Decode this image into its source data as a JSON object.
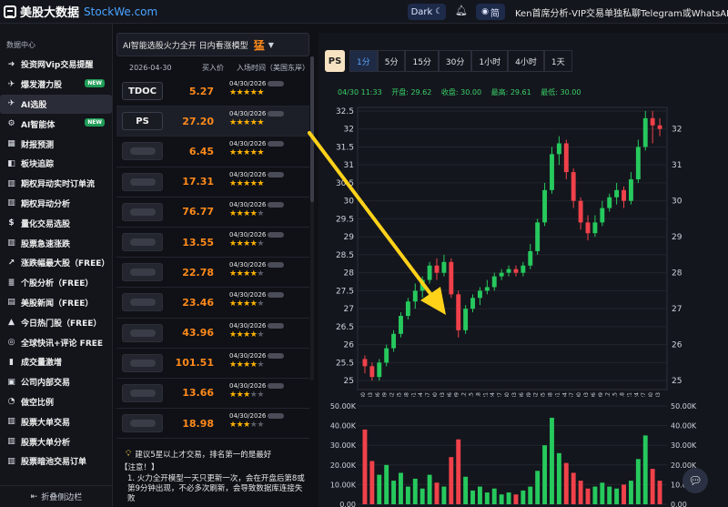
{
  "header": {
    "logo_cn": "美股大数据",
    "logo_en": "StockWe.com",
    "theme_label": "Dark",
    "lang_label": "简",
    "contact": "Ken首席分析-VIP交易单独私聊Telegram或WhatsAPP~"
  },
  "sidebar": {
    "section_label": "数据中心",
    "items": [
      {
        "label": "投资网Vip交易提醒",
        "icon": "arrow-icon",
        "badge": ""
      },
      {
        "label": "爆发潜力股",
        "icon": "rocket-icon",
        "badge": "NEW"
      },
      {
        "label": "AI选股",
        "icon": "plane-icon",
        "badge": "",
        "active": true
      },
      {
        "label": "AI智能体",
        "icon": "robot-icon",
        "badge": "NEW"
      },
      {
        "label": "财报预测",
        "icon": "grid-icon",
        "badge": ""
      },
      {
        "label": "板块追踪",
        "icon": "box-icon",
        "badge": ""
      },
      {
        "label": "期权异动实时订单流",
        "icon": "chart-icon",
        "badge": ""
      },
      {
        "label": "期权异动分析",
        "icon": "chart-icon",
        "badge": ""
      },
      {
        "label": "量化交易选股",
        "icon": "dollar-icon",
        "badge": ""
      },
      {
        "label": "股票急速涨跌",
        "icon": "chart-icon",
        "badge": ""
      },
      {
        "label": "涨跌幅最大股（FREE）",
        "icon": "trend-icon",
        "badge": ""
      },
      {
        "label": "个股分析（FREE）",
        "icon": "list-icon",
        "badge": ""
      },
      {
        "label": "美股新闻（FREE）",
        "icon": "news-icon",
        "badge": ""
      },
      {
        "label": "今日热门股（FREE）",
        "icon": "hot-icon",
        "badge": ""
      },
      {
        "label": "全球快讯+评论 FREE",
        "icon": "globe-icon",
        "badge": ""
      },
      {
        "label": "成交量激增",
        "icon": "volume-icon",
        "badge": ""
      },
      {
        "label": "公司内部交易",
        "icon": "building-icon",
        "badge": ""
      },
      {
        "label": "做空比例",
        "icon": "pie-icon",
        "badge": ""
      },
      {
        "label": "股票大单交易",
        "icon": "chart-icon",
        "badge": ""
      },
      {
        "label": "股票大单分析",
        "icon": "chart-icon",
        "badge": ""
      },
      {
        "label": "股票暗池交易订单",
        "icon": "chart-icon",
        "badge": ""
      }
    ],
    "collapse_label": "折叠侧边栏"
  },
  "model": {
    "title": "AI智能选股火力全开 日内看涨模型",
    "hot_mark": "猛"
  },
  "list": {
    "headers": {
      "date": "2026-04-30",
      "price": "买入价",
      "time": "入场时间（美国东岸）"
    },
    "rows": [
      {
        "ticker": "TDOC",
        "price": "5.27",
        "date": "04/30/2026",
        "stars": 5
      },
      {
        "ticker": "PS",
        "price": "27.20",
        "date": "04/30/2026",
        "stars": 5,
        "selected": true
      },
      {
        "ticker": "",
        "price": "6.45",
        "date": "04/30/2026",
        "stars": 5
      },
      {
        "ticker": "",
        "price": "17.31",
        "date": "04/30/2026",
        "stars": 5
      },
      {
        "ticker": "",
        "price": "76.77",
        "date": "04/30/2026",
        "stars": 4
      },
      {
        "ticker": "",
        "price": "13.55",
        "date": "04/30/2026",
        "stars": 4
      },
      {
        "ticker": "",
        "price": "22.78",
        "date": "04/30/2026",
        "stars": 4
      },
      {
        "ticker": "",
        "price": "23.46",
        "date": "04/30/2026",
        "stars": 4
      },
      {
        "ticker": "",
        "price": "43.96",
        "date": "04/30/2026",
        "stars": 4
      },
      {
        "ticker": "",
        "price": "101.51",
        "date": "04/30/2026",
        "stars": 4
      },
      {
        "ticker": "",
        "price": "13.66",
        "date": "04/30/2026",
        "stars": 3
      },
      {
        "ticker": "",
        "price": "18.98",
        "date": "04/30/2026",
        "stars": 3
      }
    ]
  },
  "advice": {
    "tip": "建议5星以上才交易，排名第一的是最好",
    "note_title": "【注意！】",
    "note_body": "1. 火力全开模型一天只更新一次，会在开盘后第8或第9分钟出现，不必多次刷新，会导致数据库连接失败"
  },
  "chart": {
    "symbol": "PS",
    "timeframes": [
      "1分",
      "5分",
      "15分",
      "30分",
      "1小时",
      "4小时",
      "1天"
    ],
    "active_timeframe": "1分",
    "ohlc": {
      "time": "04/30 11:33",
      "open": "开盘: 29.62",
      "close": "收盘: 30.00",
      "high": "最高: 29.61",
      "low": "最低: 30.00"
    },
    "colors": {
      "up": "#26c95d",
      "down": "#f0414a",
      "axis_text": "#cfd3dc",
      "grid": "#22252e",
      "arrow": "#ffd21a"
    }
  },
  "chart_data": {
    "type": "candlestick",
    "price_axis": {
      "ylim": [
        24.75,
        32.6
      ],
      "ticks": [
        "32.5",
        "32",
        "31.5",
        "31",
        "30.5",
        "30",
        "29.5",
        "29",
        "28.5",
        "28",
        "27.5",
        "27",
        "26.5",
        "26",
        "25.5",
        "25"
      ]
    },
    "right_axis": {
      "ticks": [
        "32",
        "31",
        "30",
        "29",
        "28",
        "27",
        "26",
        "25"
      ]
    },
    "x_ticks": [
      "09:30",
      "09:33",
      "09:36",
      "09:39",
      "09:42",
      "09:45",
      "09:48",
      "09:51",
      "09:54",
      "09:57",
      "10:00",
      "10:03",
      "10:06",
      "10:09",
      "10:12",
      "10:15",
      "10:18",
      "10:21",
      "10:24",
      "10:27",
      "10:30",
      "10:33",
      "10:36",
      "10:39",
      "10:42",
      "10:45",
      "10:48",
      "10:51",
      "10:54",
      "10:57",
      "11:00",
      "11:03",
      "11:06",
      "11:09",
      "11:12",
      "11:15",
      "11:18",
      "11:21",
      "11:24",
      "11:27",
      "11:30",
      "11:33"
    ],
    "series": [
      {
        "o": 25.6,
        "c": 25.4,
        "h": 25.7,
        "l": 25.2
      },
      {
        "o": 25.4,
        "c": 25.1,
        "h": 25.5,
        "l": 25.0
      },
      {
        "o": 25.1,
        "c": 25.5,
        "h": 25.6,
        "l": 25.0
      },
      {
        "o": 25.5,
        "c": 25.9,
        "h": 26.0,
        "l": 25.4
      },
      {
        "o": 25.9,
        "c": 26.3,
        "h": 26.4,
        "l": 25.8
      },
      {
        "o": 26.3,
        "c": 26.8,
        "h": 26.9,
        "l": 26.2
      },
      {
        "o": 26.8,
        "c": 27.2,
        "h": 27.3,
        "l": 26.7
      },
      {
        "o": 27.2,
        "c": 27.5,
        "h": 27.7,
        "l": 27.0
      },
      {
        "o": 27.5,
        "c": 27.8,
        "h": 27.9,
        "l": 27.3
      },
      {
        "o": 27.8,
        "c": 28.2,
        "h": 28.3,
        "l": 27.7
      },
      {
        "o": 28.2,
        "c": 28.0,
        "h": 28.4,
        "l": 27.8
      },
      {
        "o": 28.0,
        "c": 28.3,
        "h": 28.5,
        "l": 27.9
      },
      {
        "o": 28.3,
        "c": 27.4,
        "h": 28.4,
        "l": 27.3
      },
      {
        "o": 27.4,
        "c": 26.4,
        "h": 27.5,
        "l": 26.2
      },
      {
        "o": 26.4,
        "c": 27.0,
        "h": 27.1,
        "l": 26.3
      },
      {
        "o": 27.0,
        "c": 27.3,
        "h": 27.4,
        "l": 26.9
      },
      {
        "o": 27.3,
        "c": 27.5,
        "h": 27.6,
        "l": 27.1
      },
      {
        "o": 27.5,
        "c": 27.6,
        "h": 27.8,
        "l": 27.4
      },
      {
        "o": 27.6,
        "c": 27.9,
        "h": 28.0,
        "l": 27.5
      },
      {
        "o": 27.9,
        "c": 28.0,
        "h": 28.1,
        "l": 27.8
      },
      {
        "o": 28.0,
        "c": 28.1,
        "h": 28.2,
        "l": 27.9
      },
      {
        "o": 28.1,
        "c": 28.0,
        "h": 28.2,
        "l": 27.9
      },
      {
        "o": 28.0,
        "c": 28.2,
        "h": 28.3,
        "l": 27.9
      },
      {
        "o": 28.2,
        "c": 28.6,
        "h": 28.8,
        "l": 28.1
      },
      {
        "o": 28.6,
        "c": 29.4,
        "h": 29.5,
        "l": 28.5
      },
      {
        "o": 29.4,
        "c": 30.3,
        "h": 30.5,
        "l": 29.3
      },
      {
        "o": 30.3,
        "c": 31.3,
        "h": 31.5,
        "l": 30.2
      },
      {
        "o": 31.3,
        "c": 31.6,
        "h": 31.8,
        "l": 31.0
      },
      {
        "o": 31.6,
        "c": 30.8,
        "h": 31.7,
        "l": 30.6
      },
      {
        "o": 30.8,
        "c": 30.0,
        "h": 30.9,
        "l": 29.8
      },
      {
        "o": 30.0,
        "c": 29.4,
        "h": 30.1,
        "l": 29.2
      },
      {
        "o": 29.4,
        "c": 29.1,
        "h": 29.6,
        "l": 28.9
      },
      {
        "o": 29.1,
        "c": 29.4,
        "h": 29.6,
        "l": 29.0
      },
      {
        "o": 29.4,
        "c": 29.8,
        "h": 30.0,
        "l": 29.3
      },
      {
        "o": 29.8,
        "c": 30.1,
        "h": 30.2,
        "l": 29.7
      },
      {
        "o": 30.1,
        "c": 30.3,
        "h": 30.5,
        "l": 29.9
      },
      {
        "o": 30.3,
        "c": 30.0,
        "h": 30.4,
        "l": 29.8
      },
      {
        "o": 30.0,
        "c": 30.6,
        "h": 30.8,
        "l": 29.9
      },
      {
        "o": 30.6,
        "c": 31.5,
        "h": 31.7,
        "l": 30.5
      },
      {
        "o": 31.5,
        "c": 32.3,
        "h": 32.5,
        "l": 31.4
      },
      {
        "o": 32.3,
        "c": 32.1,
        "h": 32.5,
        "l": 31.6
      },
      {
        "o": 32.1,
        "c": 32.0,
        "h": 32.3,
        "l": 31.8
      }
    ],
    "volume_axis": {
      "ylim": [
        0,
        50000
      ],
      "ticks": [
        "50.00K",
        "40.00K",
        "30.00K",
        "20.00K",
        "10.00K",
        "0.00"
      ]
    },
    "volume": [
      38000,
      22000,
      15000,
      20000,
      12000,
      16000,
      9000,
      13000,
      8000,
      15000,
      11000,
      9000,
      24000,
      33000,
      14000,
      7000,
      9000,
      6000,
      8000,
      5000,
      6000,
      5000,
      7000,
      9000,
      17000,
      30000,
      44000,
      26000,
      21000,
      16000,
      12000,
      8000,
      9000,
      11000,
      9000,
      8000,
      10000,
      12000,
      23000,
      35000,
      18000,
      12000
    ]
  }
}
